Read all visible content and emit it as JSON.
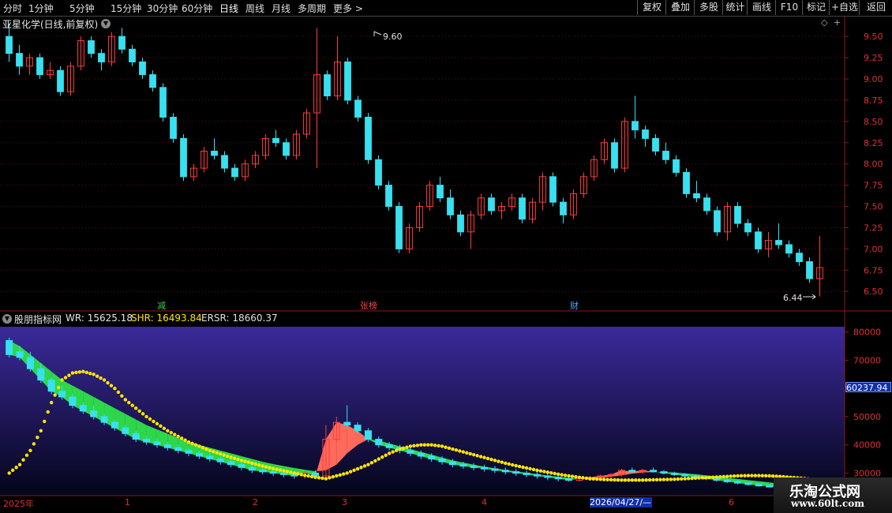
{
  "toolbar": {
    "left": [
      "分时",
      "1分钟",
      "5分钟",
      "15分钟",
      "30分钟",
      "60分钟",
      "日线",
      "周线",
      "月线",
      "多周期",
      "更多 >"
    ],
    "active": "日线",
    "right": [
      "复权",
      "叠加",
      "多股",
      "统计",
      "画线",
      "F10",
      "标记",
      "+自选",
      "返回"
    ]
  },
  "stock": {
    "title": "亚星化学(日线,前复权)",
    "high_label": "9.60",
    "low_label": "6.44"
  },
  "main_yaxis": [
    "9.50",
    "9.25",
    "9.00",
    "8.75",
    "8.50",
    "8.25",
    "8.00",
    "7.75",
    "7.50",
    "7.25",
    "7.00",
    "6.75",
    "6.50"
  ],
  "markers": {
    "jian": "减",
    "zb": "张榜",
    "cai": "财"
  },
  "indicator": {
    "name": "股朋指标网",
    "wr": "WR: 15625.18",
    "shr": "SHR: 16493.84",
    "ersr": "ERSR: 18660.37",
    "current_value": "60237.94",
    "yaxis": [
      "80000",
      "70000",
      "50000",
      "40000",
      "30000"
    ]
  },
  "xaxis": {
    "labels": [
      "2025年",
      "1",
      "2",
      "3",
      "4",
      "6"
    ],
    "cursor_date": "2026/04/27/—"
  },
  "watermark": {
    "name": "乐淘公式网",
    "url": "www.60lt.com"
  },
  "colors": {
    "up": "#ff3c3c",
    "down": "#38e0f0",
    "axis": "#8b1a1a",
    "dots": "#ffe600",
    "band_green": "#2ed64a",
    "band_red": "#ff6a5a"
  },
  "chart_data": {
    "type": "candlestick",
    "ylim": [
      6.4,
      9.65
    ],
    "candles": [
      [
        9.5,
        9.65,
        9.2,
        9.3
      ],
      [
        9.3,
        9.4,
        9.05,
        9.15
      ],
      [
        9.15,
        9.3,
        9.05,
        9.25
      ],
      [
        9.25,
        9.3,
        9.0,
        9.05
      ],
      [
        9.05,
        9.2,
        9.0,
        9.1
      ],
      [
        9.1,
        9.15,
        8.8,
        8.85
      ],
      [
        8.85,
        9.2,
        8.8,
        9.15
      ],
      [
        9.15,
        9.5,
        9.1,
        9.45
      ],
      [
        9.45,
        9.5,
        9.25,
        9.3
      ],
      [
        9.3,
        9.35,
        9.1,
        9.2
      ],
      [
        9.2,
        9.55,
        9.15,
        9.5
      ],
      [
        9.5,
        9.6,
        9.3,
        9.35
      ],
      [
        9.35,
        9.4,
        9.15,
        9.2
      ],
      [
        9.2,
        9.25,
        9.0,
        9.05
      ],
      [
        9.05,
        9.1,
        8.85,
        8.9
      ],
      [
        8.9,
        8.95,
        8.5,
        8.55
      ],
      [
        8.55,
        8.6,
        8.25,
        8.3
      ],
      [
        8.3,
        8.35,
        7.8,
        7.85
      ],
      [
        7.85,
        8.0,
        7.8,
        7.95
      ],
      [
        7.95,
        8.2,
        7.9,
        8.15
      ],
      [
        8.15,
        8.3,
        8.05,
        8.1
      ],
      [
        8.1,
        8.15,
        7.9,
        7.95
      ],
      [
        7.95,
        8.0,
        7.8,
        7.85
      ],
      [
        7.85,
        8.05,
        7.8,
        8.0
      ],
      [
        8.0,
        8.15,
        7.95,
        8.1
      ],
      [
        8.1,
        8.35,
        8.05,
        8.3
      ],
      [
        8.3,
        8.4,
        8.2,
        8.25
      ],
      [
        8.25,
        8.3,
        8.05,
        8.1
      ],
      [
        8.1,
        8.4,
        8.05,
        8.35
      ],
      [
        8.35,
        8.65,
        8.3,
        8.6
      ],
      [
        8.6,
        9.6,
        7.95,
        9.05
      ],
      [
        9.05,
        9.1,
        8.75,
        8.8
      ],
      [
        8.8,
        9.5,
        8.75,
        9.2
      ],
      [
        9.2,
        9.25,
        8.7,
        8.75
      ],
      [
        8.75,
        8.8,
        8.5,
        8.55
      ],
      [
        8.55,
        8.6,
        8.0,
        8.05
      ],
      [
        8.05,
        8.1,
        7.7,
        7.75
      ],
      [
        7.75,
        7.8,
        7.45,
        7.5
      ],
      [
        7.5,
        7.55,
        6.95,
        7.0
      ],
      [
        7.0,
        7.3,
        6.95,
        7.25
      ],
      [
        7.25,
        7.55,
        7.2,
        7.5
      ],
      [
        7.5,
        7.8,
        7.45,
        7.75
      ],
      [
        7.75,
        7.85,
        7.55,
        7.6
      ],
      [
        7.6,
        7.7,
        7.35,
        7.4
      ],
      [
        7.4,
        7.45,
        7.15,
        7.2
      ],
      [
        7.2,
        7.45,
        7.0,
        7.4
      ],
      [
        7.4,
        7.65,
        7.35,
        7.6
      ],
      [
        7.6,
        7.65,
        7.4,
        7.45
      ],
      [
        7.45,
        7.55,
        7.35,
        7.5
      ],
      [
        7.5,
        7.65,
        7.45,
        7.6
      ],
      [
        7.6,
        7.65,
        7.3,
        7.35
      ],
      [
        7.35,
        7.6,
        7.3,
        7.55
      ],
      [
        7.55,
        7.9,
        7.45,
        7.85
      ],
      [
        7.85,
        7.9,
        7.5,
        7.55
      ],
      [
        7.55,
        7.6,
        7.3,
        7.4
      ],
      [
        7.4,
        7.7,
        7.35,
        7.65
      ],
      [
        7.65,
        7.9,
        7.6,
        7.85
      ],
      [
        7.85,
        8.1,
        7.8,
        8.05
      ],
      [
        8.05,
        8.3,
        8.0,
        8.25
      ],
      [
        8.25,
        8.3,
        7.9,
        7.95
      ],
      [
        7.95,
        8.55,
        7.9,
        8.5
      ],
      [
        8.5,
        8.8,
        8.3,
        8.4
      ],
      [
        8.4,
        8.45,
        8.2,
        8.3
      ],
      [
        8.3,
        8.35,
        8.1,
        8.15
      ],
      [
        8.15,
        8.25,
        8.0,
        8.05
      ],
      [
        8.05,
        8.1,
        7.85,
        7.9
      ],
      [
        7.9,
        7.95,
        7.6,
        7.65
      ],
      [
        7.65,
        7.8,
        7.55,
        7.6
      ],
      [
        7.6,
        7.65,
        7.4,
        7.45
      ],
      [
        7.45,
        7.5,
        7.15,
        7.2
      ],
      [
        7.2,
        7.55,
        7.1,
        7.5
      ],
      [
        7.5,
        7.55,
        7.25,
        7.3
      ],
      [
        7.3,
        7.35,
        7.15,
        7.2
      ],
      [
        7.2,
        7.25,
        6.95,
        7.0
      ],
      [
        7.0,
        7.2,
        6.9,
        7.1
      ],
      [
        7.1,
        7.3,
        7.0,
        7.05
      ],
      [
        7.05,
        7.1,
        6.9,
        6.95
      ],
      [
        6.95,
        7.0,
        6.8,
        6.85
      ],
      [
        6.85,
        6.9,
        6.6,
        6.65
      ],
      [
        6.65,
        7.15,
        6.44,
        6.78
      ]
    ],
    "indicator": {
      "ylim": [
        22000,
        83000
      ],
      "candles": [
        [
          77000,
          78000,
          71000,
          72000
        ],
        [
          73000,
          75000,
          70000,
          71000
        ],
        [
          71000,
          73000,
          66000,
          67000
        ],
        [
          67000,
          69000,
          62000,
          63000
        ],
        [
          63000,
          64000,
          58000,
          59000
        ],
        [
          59000,
          61000,
          56000,
          57000
        ],
        [
          57000,
          58000,
          53000,
          54000
        ],
        [
          54000,
          55000,
          51000,
          52000
        ],
        [
          52000,
          54000,
          49000,
          50000
        ],
        [
          50000,
          51000,
          47000,
          48000
        ],
        [
          48000,
          49000,
          45000,
          46000
        ],
        [
          46000,
          47000,
          43000,
          44000
        ],
        [
          44000,
          45000,
          41000,
          42000
        ],
        [
          42000,
          43000,
          40000,
          41000
        ],
        [
          41000,
          42000,
          39000,
          40000
        ],
        [
          40000,
          41000,
          38000,
          39000
        ],
        [
          39000,
          40000,
          37000,
          38000
        ],
        [
          38000,
          39000,
          36000,
          37000
        ],
        [
          37000,
          38000,
          35000,
          36000
        ],
        [
          36000,
          37000,
          34000,
          35000
        ],
        [
          35000,
          36000,
          33000,
          34000
        ],
        [
          34000,
          35000,
          32000,
          33000
        ],
        [
          33000,
          34000,
          31000,
          32000
        ],
        [
          32000,
          33000,
          30000,
          31000
        ],
        [
          31000,
          32000,
          29500,
          30500
        ],
        [
          30500,
          31500,
          29000,
          30000
        ],
        [
          30000,
          31000,
          28500,
          29500
        ],
        [
          29500,
          30500,
          28000,
          29000
        ],
        [
          29000,
          30500,
          28000,
          30000
        ],
        [
          30000,
          31000,
          28500,
          29000
        ],
        [
          29000,
          47000,
          28000,
          42000
        ],
        [
          42000,
          50000,
          41000,
          48000
        ],
        [
          48000,
          54000,
          46000,
          47000
        ],
        [
          47000,
          48000,
          44000,
          45000
        ],
        [
          45000,
          46000,
          41000,
          42000
        ],
        [
          42000,
          43000,
          39000,
          40000
        ],
        [
          40000,
          41000,
          38000,
          39000
        ],
        [
          39000,
          40000,
          37000,
          38000
        ],
        [
          38000,
          39000,
          36000,
          37000
        ],
        [
          37000,
          38000,
          35000,
          36000
        ],
        [
          36000,
          37000,
          34000,
          35000
        ],
        [
          35000,
          36000,
          33000,
          34000
        ],
        [
          34000,
          35000,
          32000,
          33000
        ],
        [
          33000,
          34000,
          31500,
          32500
        ],
        [
          32500,
          33500,
          31000,
          32000
        ],
        [
          32000,
          33000,
          30500,
          31500
        ],
        [
          31500,
          32500,
          30000,
          31000
        ],
        [
          31000,
          32000,
          29500,
          30500
        ],
        [
          30500,
          31500,
          29000,
          30000
        ],
        [
          30000,
          31000,
          28500,
          29500
        ],
        [
          29500,
          30500,
          28000,
          29000
        ],
        [
          29000,
          30000,
          27500,
          28500
        ],
        [
          28500,
          29500,
          27000,
          28000
        ],
        [
          28000,
          29000,
          27000,
          27500
        ],
        [
          27500,
          28500,
          27000,
          28000
        ],
        [
          28000,
          29000,
          27200,
          28500
        ],
        [
          28500,
          29500,
          27800,
          29000
        ],
        [
          29000,
          30000,
          28300,
          29500
        ],
        [
          29500,
          31500,
          28800,
          31000
        ],
        [
          31000,
          32000,
          30000,
          30500
        ],
        [
          30500,
          31500,
          29800,
          31000
        ],
        [
          31000,
          32000,
          30200,
          30500
        ],
        [
          30500,
          31000,
          29500,
          30000
        ],
        [
          30000,
          30500,
          29000,
          29500
        ],
        [
          29500,
          30000,
          28500,
          29000
        ],
        [
          29000,
          29500,
          28000,
          28500
        ],
        [
          28500,
          29000,
          27500,
          28000
        ],
        [
          28000,
          28500,
          27000,
          27500
        ],
        [
          27500,
          28000,
          26500,
          27000
        ],
        [
          27000,
          27500,
          26000,
          26500
        ],
        [
          26500,
          27000,
          25500,
          26000
        ],
        [
          26000,
          26500,
          25200,
          25600
        ],
        [
          25600,
          26000,
          25000,
          25300
        ],
        [
          25300,
          25800,
          24800,
          25100
        ],
        [
          25100,
          25600,
          24600,
          24900
        ],
        [
          24900,
          25400,
          24400,
          24700
        ],
        [
          24700,
          25200,
          24200,
          24500
        ],
        [
          24500,
          25000,
          24000,
          24300
        ],
        [
          24300,
          24800,
          23800,
          24100
        ],
        [
          24100,
          24600,
          23600,
          23900
        ]
      ],
      "shr_line": [
        77000,
        75000,
        72000,
        69000,
        66000,
        63000,
        61000,
        59000,
        57000,
        55000,
        53000,
        51000,
        49000,
        47000,
        45500,
        44000,
        42500,
        41000,
        40000,
        39000,
        38000,
        37000,
        36000,
        35000,
        34000,
        33200,
        32500,
        31800,
        31200,
        30600,
        31000,
        33000,
        37000,
        40000,
        42000,
        41500,
        40500,
        39500,
        38500,
        37500,
        36500,
        35500,
        34500,
        33700,
        33000,
        32300,
        31700,
        31100,
        30600,
        30100,
        29600,
        29100,
        28700,
        28300,
        28000,
        28000,
        28300,
        28700,
        29200,
        29800,
        30200,
        30400,
        30400,
        30200,
        29900,
        29600,
        29200,
        28800,
        28300,
        27900,
        27500,
        27100,
        26700,
        26300,
        26000,
        25700,
        25400,
        25100,
        24800,
        24500
      ],
      "wr_dots": [
        30000,
        33000,
        38000,
        45000,
        55000,
        63000,
        65500,
        66000,
        65000,
        63000,
        60000,
        56000,
        53000,
        50000,
        47500,
        45000,
        43000,
        41000,
        39500,
        38000,
        36800,
        35600,
        34500,
        33500,
        32500,
        31600,
        30800,
        30000,
        29200,
        28500,
        28000,
        29000,
        30000,
        31500,
        33000,
        35000,
        37000,
        38500,
        39500,
        40000,
        40000,
        39500,
        38500,
        37500,
        36500,
        35500,
        34500,
        33500,
        32600,
        31800,
        31000,
        30300,
        29600,
        29000,
        28500,
        28000,
        27800,
        27600,
        27500,
        27500,
        27500,
        27600,
        27700,
        27800,
        28000,
        28200,
        28400,
        28600,
        28800,
        29000,
        29100,
        29100,
        29000,
        28800,
        28500,
        28200,
        27800,
        27400,
        27000,
        26500
      ]
    }
  }
}
